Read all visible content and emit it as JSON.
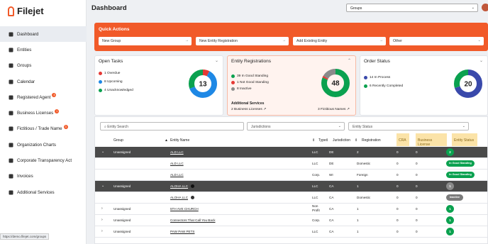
{
  "app": {
    "logo_text": "Filejet",
    "status_url": "https://demo.filejet.com/groups"
  },
  "sidebar": {
    "items": [
      {
        "label": "Dashboard",
        "icon": "grid-icon",
        "active": true
      },
      {
        "label": "Entities",
        "icon": "globe-icon"
      },
      {
        "label": "Groups",
        "icon": "folder-icon"
      },
      {
        "label": "Calendar",
        "icon": "calendar-icon"
      },
      {
        "label": "Registered Agent",
        "icon": "person-icon",
        "badge": "4"
      },
      {
        "label": "Business Licenses",
        "icon": "license-icon",
        "badge": "1"
      },
      {
        "label": "Fictitious / Trade Name",
        "icon": "tag-icon",
        "badge": "3"
      },
      {
        "label": "Organization Charts",
        "icon": "org-chart-icon"
      },
      {
        "label": "Corporate Transparency Act",
        "icon": "building-icon"
      },
      {
        "label": "Invoices",
        "icon": "invoice-icon"
      },
      {
        "label": "Additional Services",
        "icon": "services-icon"
      }
    ]
  },
  "header": {
    "title": "Dashboard",
    "group_select": "Groups"
  },
  "quick_actions": {
    "title": "Quick Actions",
    "buttons": [
      "New Group",
      "New Entity Registration",
      "Add Existing Entity"
    ],
    "other_select": "Other"
  },
  "open_tasks": {
    "title": "Open Tasks",
    "total": "13",
    "legend": [
      {
        "label": "1 Overdue",
        "color": "#e53935",
        "value": 1
      },
      {
        "label": "8 Upcoming",
        "color": "#1e88e5",
        "value": 8
      },
      {
        "label": "4 Unacknowledged",
        "color": "#0aa14f",
        "value": 4
      }
    ]
  },
  "entity_registrations": {
    "title": "Entity Registrations",
    "total": "48",
    "legend": [
      {
        "label": "39 In Good Standing",
        "color": "#0aa14f",
        "value": 39
      },
      {
        "label": "1 Not Good Standing",
        "color": "#e53935",
        "value": 1
      },
      {
        "label": "8 Inactive",
        "color": "#8a8a8a",
        "value": 8
      }
    ],
    "additional_services": "Additional Services",
    "business_licenses": "2 Business Licenses",
    "fictitious_names": "3 Fictitious Names"
  },
  "order_status": {
    "title": "Order Status",
    "total": "20",
    "legend": [
      {
        "label": "14 In Process",
        "color": "#3949ab",
        "value": 14
      },
      {
        "label": "6 Recently Completed",
        "color": "#0aa14f",
        "value": 6
      }
    ]
  },
  "table": {
    "search_placeholder": "Entity Search",
    "jurisdictions_filter": "Jurisdictions",
    "status_filter": "Entity Status",
    "headers": {
      "group": "Group",
      "entity_name": "Entity Name",
      "type": "Type",
      "jurisdiction": "Jurisdiction",
      "registration": "Registration",
      "cra": "CRA",
      "business_license": "Business License",
      "entity_status": "Entity Status"
    },
    "rows": [
      {
        "style": "dark",
        "expand": "⌄",
        "group": "Unassigned",
        "name": "ALD LLC",
        "type": "LLC",
        "jur": "DE",
        "reg": "2",
        "cra": "0",
        "bl": "0",
        "status": "2",
        "status_kind": "circle"
      },
      {
        "style": "sub",
        "expand": "",
        "group": "",
        "name": "ALD LLC",
        "type": "LLC",
        "jur": "DE",
        "reg": "Domestic",
        "cra": "0",
        "bl": "0",
        "status": "In Good Standing",
        "status_kind": "pill"
      },
      {
        "style": "sub",
        "expand": "",
        "group": "",
        "name": "ALD LLC",
        "type": "Corp.",
        "jur": "WI",
        "reg": "Foreign",
        "cra": "0",
        "bl": "0",
        "status": "In Good Standing",
        "status_kind": "pill"
      },
      {
        "style": "dark",
        "expand": "⌄",
        "group": "Unassigned",
        "name": "ALOHA LLC",
        "type": "LLC",
        "jur": "CA",
        "reg": "1",
        "cra": "0",
        "bl": "0",
        "status": "1",
        "status_kind": "circle-grey",
        "dot": true
      },
      {
        "style": "sub",
        "expand": "",
        "group": "",
        "name": "ALOHA LLC",
        "type": "LLC",
        "jur": "CA",
        "reg": "Domestic",
        "cra": "0",
        "bl": "0",
        "status": "Inactive",
        "status_kind": "pill-grey",
        "dot": true
      },
      {
        "style": "normal",
        "expand": "›",
        "group": "Unassigned",
        "name": "5TH AVE CHURCH",
        "type": "Non Profit",
        "jur": "CA",
        "reg": "1",
        "cra": "0",
        "bl": "0",
        "status": "1",
        "status_kind": "circle"
      },
      {
        "style": "normal",
        "expand": "›",
        "group": "Unassigned",
        "name": "Connectors That Call You Back",
        "type": "Corp.",
        "jur": "CA",
        "reg": "1",
        "cra": "0",
        "bl": "0",
        "status": "1",
        "status_kind": "circle"
      },
      {
        "style": "normal",
        "expand": "›",
        "group": "Unassigned",
        "name": "PAW PAW PETS",
        "type": "LLC",
        "jur": "CA",
        "reg": "1",
        "cra": "0",
        "bl": "0",
        "status": "1",
        "status_kind": "circle"
      }
    ]
  }
}
